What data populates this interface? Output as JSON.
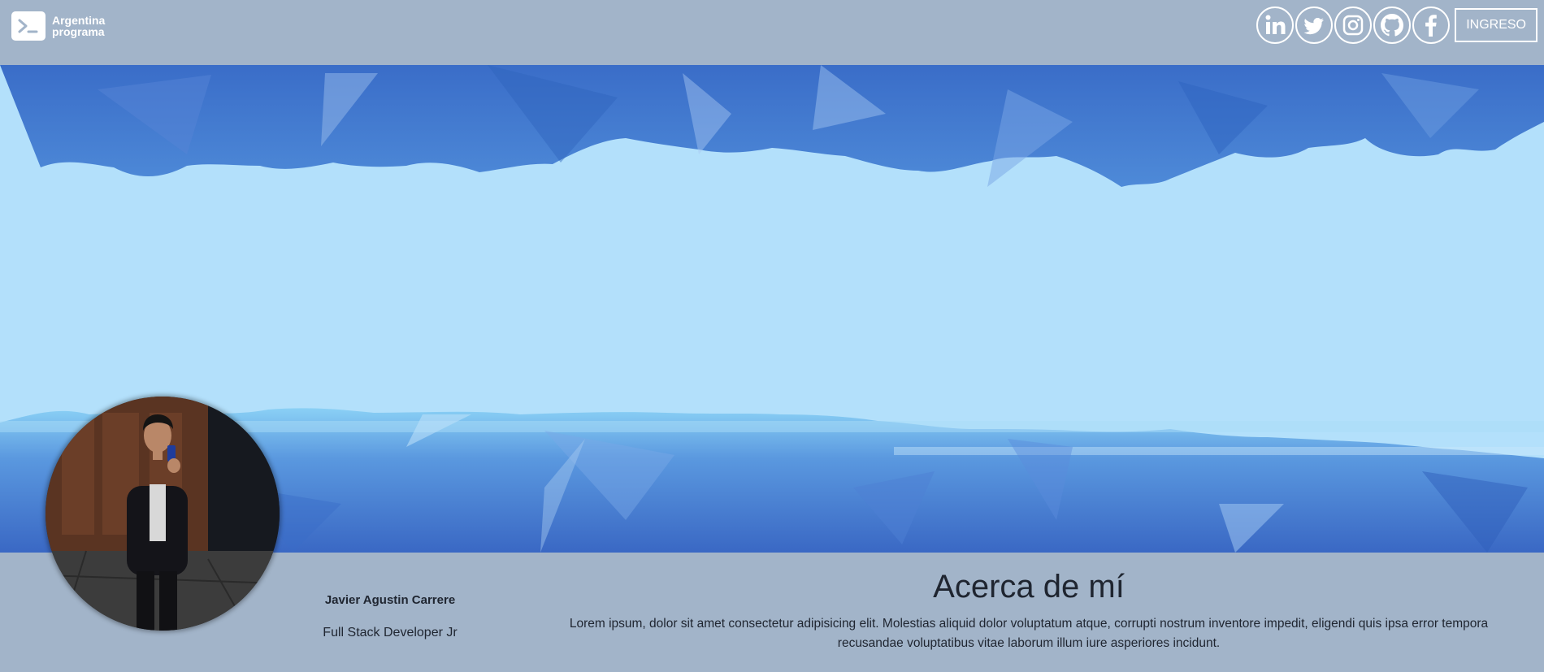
{
  "header": {
    "logo_line1": "Argentina",
    "logo_line2": "programa",
    "logo_icon": "terminal-prompt-icon",
    "socials": [
      {
        "name": "linkedin-icon"
      },
      {
        "name": "twitter-icon"
      },
      {
        "name": "instagram-icon"
      },
      {
        "name": "github-icon"
      },
      {
        "name": "facebook-icon"
      }
    ],
    "login_label": "INGRESO"
  },
  "profile": {
    "name": "Javier Agustin Carrere",
    "role": "Full Stack Developer Jr"
  },
  "about": {
    "title": "Acerca de mí",
    "text": "Lorem ipsum, dolor sit amet consectetur adipisicing elit. Molestias aliquid dolor voluptatum atque, corrupti nostrum inventore impedit, eligendi quis ipsa error tempora recusandae voluptatibus vitae laborum illum iure asperiores incidunt."
  },
  "colors": {
    "page_bg": "#a2b4c9",
    "banner_light": "#b3e0fb",
    "banner_blue": "#3f74cc",
    "text": "#1f2530",
    "header_text": "#ffffff"
  }
}
